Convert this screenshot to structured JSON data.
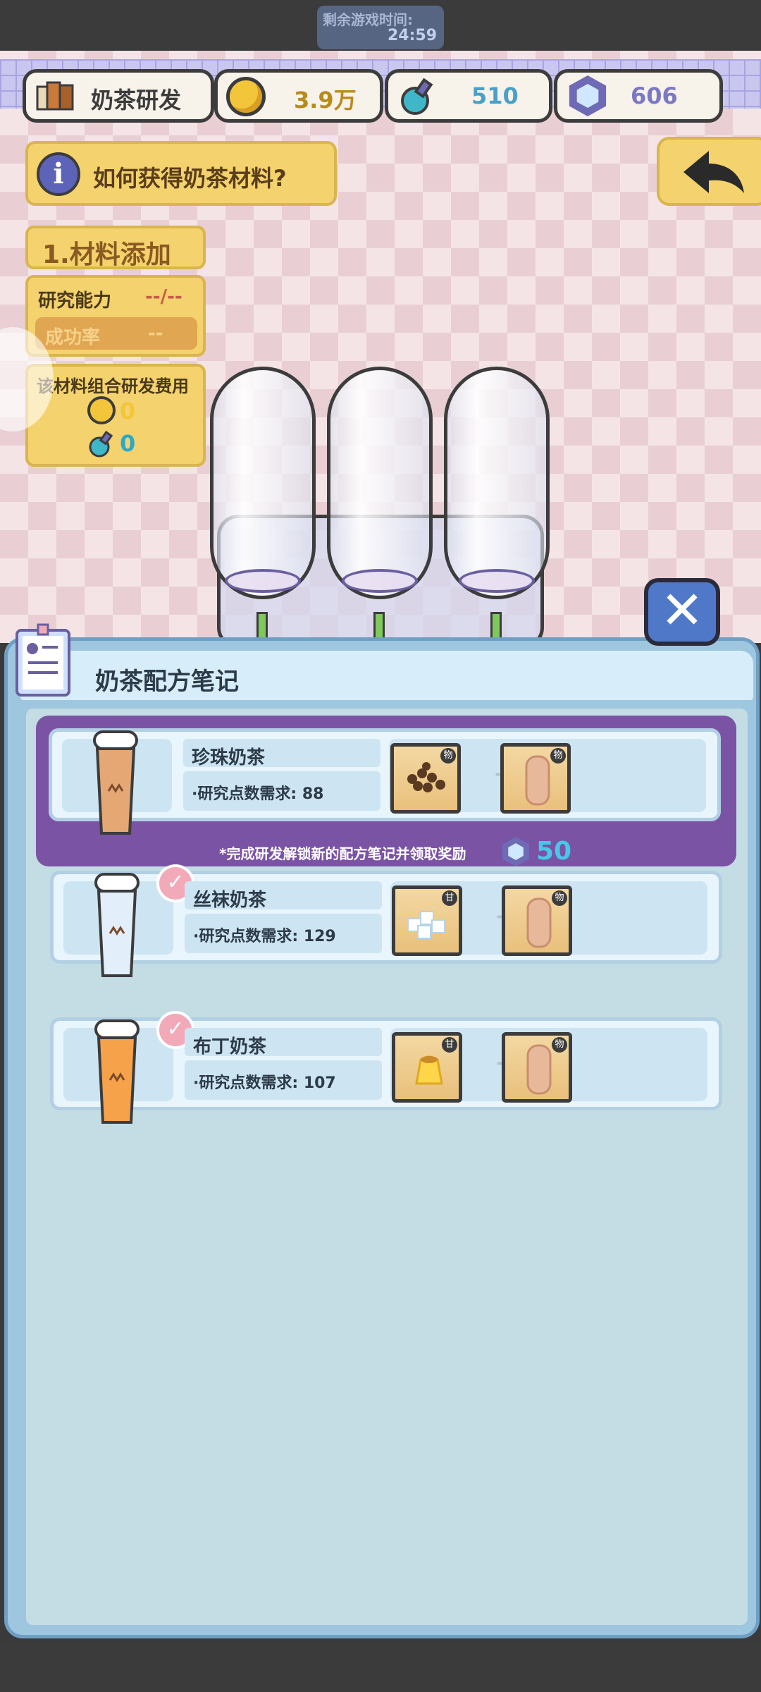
{
  "timer": {
    "label": "剩余游戏时间:",
    "value": "24:59"
  },
  "resources": {
    "title": "奶茶研发",
    "gold": "3.9万",
    "potion": "510",
    "gems": "606"
  },
  "info_button": "如何获得奶茶材料?",
  "step_title": "1.材料添加",
  "stats": {
    "ability_label": "研究能力",
    "ability_value": "--/--",
    "success_label": "成功率",
    "success_value": "--"
  },
  "cost": {
    "label": "该材料组合研发费用",
    "gold": "0",
    "potion": "0"
  },
  "panel": {
    "title": "奶茶配方笔记",
    "reward_note": "*完成研发解锁新的配方笔记并领取奖励",
    "reward_value": "50",
    "recipes": [
      {
        "name": "珍珠奶茶",
        "requirement": "·研究点数需求: 88",
        "ing1_tag": "物",
        "ing2_tag": "物",
        "checked": false,
        "cup_color": "#e5a774"
      },
      {
        "name": "丝袜奶茶",
        "requirement": "·研究点数需求: 129",
        "ing1_tag": "甘",
        "ing2_tag": "物",
        "checked": true,
        "cup_color": "#e2eefa"
      },
      {
        "name": "布丁奶茶",
        "requirement": "·研究点数需求: 107",
        "ing1_tag": "甘",
        "ing2_tag": "物",
        "checked": true,
        "cup_color": "#f6a24a"
      }
    ]
  },
  "close_symbol": "✕",
  "check_symbol": "✓",
  "info_symbol": "i"
}
